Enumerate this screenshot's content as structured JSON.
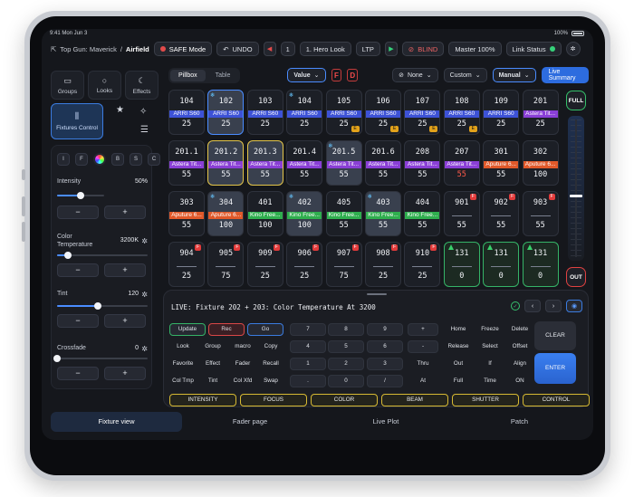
{
  "status": {
    "time": "9:41 Mon Jun 3",
    "battery": "100%"
  },
  "topbar": {
    "show": "Top Gun: Maverick",
    "separator": "/",
    "scene": "Airfield",
    "safe_mode": "SAFE Mode",
    "undo": "UNDO",
    "cue_number": "1",
    "cue_name": "1. Hero Look",
    "ltp": "LTP",
    "blind": "BLIND",
    "master": "Master 100%",
    "link_status": "Link Status"
  },
  "left": {
    "modes": [
      {
        "label": "Groups",
        "icon": "folder-icon"
      },
      {
        "label": "Looks",
        "icon": "bulb-icon"
      },
      {
        "label": "Effects",
        "icon": "moon-icon"
      }
    ],
    "fixtures_control": "Fixtures Control",
    "attributes": [
      "I",
      "F",
      "B",
      "S",
      "C"
    ],
    "params": [
      {
        "label": "Intensity",
        "value": "50%",
        "level": 0.5
      },
      {
        "label": "Color Temperature",
        "value": "3200K",
        "level": 0.12
      },
      {
        "label": "Tint",
        "value": "120",
        "level": 0.45
      },
      {
        "label": "Crossfade",
        "value": "0",
        "level": 0.0
      }
    ],
    "minus": "−",
    "plus": "+"
  },
  "toolbar": {
    "view_tabs": [
      "Pillbox",
      "Table"
    ],
    "value_dd": "Value",
    "f_btn": "F",
    "d_btn": "D",
    "none_dd": "None",
    "custom_dd": "Custom",
    "manual_dd": "Manual",
    "live_summary": "Live Summary"
  },
  "fixtures": [
    [
      {
        "num": "104",
        "band": "ARRI S60",
        "color": "#3d52d6",
        "val": "25",
        "snow": false,
        "badge": "",
        "ebadge": ""
      },
      {
        "num": "102",
        "band": "ARRI S60",
        "color": "#3d52d6",
        "val": "25",
        "snow": true,
        "sel": true,
        "border": "#4a8cff",
        "badge": "",
        "ebadge": ""
      },
      {
        "num": "103",
        "band": "ARRI S60",
        "color": "#3d52d6",
        "val": "25",
        "badge": "",
        "ebadge": ""
      },
      {
        "num": "104",
        "band": "ARRI S60",
        "color": "#3d52d6",
        "val": "25",
        "snow": true,
        "badge": "",
        "ebadge": ""
      },
      {
        "num": "105",
        "band": "ARRI S60",
        "color": "#3d52d6",
        "val": "25",
        "badge": "",
        "ebadge": "E"
      },
      {
        "num": "106",
        "band": "ARRI S60",
        "color": "#3d52d6",
        "val": "25",
        "badge": "",
        "ebadge": "E"
      },
      {
        "num": "107",
        "band": "ARRI S60",
        "color": "#3d52d6",
        "val": "25",
        "badge": "",
        "ebadge": "E"
      },
      {
        "num": "108",
        "band": "ARRI S60",
        "color": "#3d52d6",
        "val": "25",
        "badge": "",
        "ebadge": "E"
      },
      {
        "num": "109",
        "band": "ARRI S60",
        "color": "#3d52d6",
        "val": "25",
        "badge": "",
        "ebadge": ""
      },
      {
        "num": "201",
        "band": "Astera Tit...",
        "color": "#8a3fd6",
        "val": "25",
        "badge": "",
        "ebadge": ""
      }
    ],
    [
      {
        "num": "201.1",
        "band": "Astera Tit...",
        "color": "#8a3fd6",
        "val": "55"
      },
      {
        "num": "201.2",
        "band": "Astera Tit...",
        "color": "#8a3fd6",
        "val": "55",
        "sel": true,
        "border": "#e3c54a"
      },
      {
        "num": "201.3",
        "band": "Astera Tit...",
        "color": "#8a3fd6",
        "val": "55",
        "sel": true,
        "border": "#e3c54a"
      },
      {
        "num": "201.4",
        "band": "Astera Tit...",
        "color": "#8a3fd6",
        "val": "55"
      },
      {
        "num": "201.5",
        "band": "Astera Tit...",
        "color": "#8a3fd6",
        "val": "55",
        "snow": true,
        "sel": true
      },
      {
        "num": "201.6",
        "band": "Astera Tit...",
        "color": "#8a3fd6",
        "val": "55"
      },
      {
        "num": "208",
        "band": "Astera Tit...",
        "color": "#8a3fd6",
        "val": "55"
      },
      {
        "num": "207",
        "band": "Astera Tit...",
        "color": "#8a3fd6",
        "val": "55",
        "red": true
      },
      {
        "num": "301",
        "band": "Aputure 6...",
        "color": "#e0592a",
        "val": "55"
      },
      {
        "num": "302",
        "band": "Aputure 6...",
        "color": "#e0592a",
        "val": "100"
      }
    ],
    [
      {
        "num": "303",
        "band": "Aputure 6...",
        "color": "#e0592a",
        "val": "55"
      },
      {
        "num": "304",
        "band": "Aputure 6...",
        "color": "#e0592a",
        "val": "100",
        "snow": true,
        "sel": true
      },
      {
        "num": "401",
        "band": "Kino Free...",
        "color": "#2fae4e",
        "val": "100"
      },
      {
        "num": "402",
        "band": "Kino Free...",
        "color": "#2fae4e",
        "val": "100",
        "snow": true,
        "sel": true
      },
      {
        "num": "405",
        "band": "Kino Free...",
        "color": "#2fae4e",
        "val": "55"
      },
      {
        "num": "403",
        "band": "Kino Free...",
        "color": "#2fae4e",
        "val": "55",
        "snow": true,
        "sel": true
      },
      {
        "num": "404",
        "band": "Kino Free...",
        "color": "#2fae4e",
        "val": "55"
      },
      {
        "num": "901",
        "band": "",
        "color": "",
        "val": "55",
        "badge": "F",
        "line": true
      },
      {
        "num": "902",
        "band": "",
        "color": "",
        "val": "55",
        "badge": "F",
        "line": true
      },
      {
        "num": "903",
        "band": "",
        "color": "",
        "val": "55",
        "badge": "F",
        "line": true
      }
    ],
    [
      {
        "num": "904",
        "band": "",
        "color": "",
        "val": "25",
        "badge": "F",
        "line": true
      },
      {
        "num": "905",
        "band": "",
        "color": "",
        "val": "75",
        "badge": "F",
        "line": true
      },
      {
        "num": "909",
        "band": "",
        "color": "",
        "val": "25",
        "badge": "F",
        "line": true
      },
      {
        "num": "906",
        "band": "",
        "color": "",
        "val": "25",
        "badge": "F",
        "line": true
      },
      {
        "num": "907",
        "band": "",
        "color": "",
        "val": "75",
        "badge": "F",
        "line": true
      },
      {
        "num": "908",
        "band": "",
        "color": "",
        "val": "25",
        "badge": "F",
        "line": true
      },
      {
        "num": "910",
        "band": "",
        "color": "",
        "val": "25",
        "badge": "F",
        "line": true
      },
      {
        "num": "131",
        "band": "",
        "color": "",
        "val": "0",
        "green": true,
        "line": true
      },
      {
        "num": "131",
        "band": "",
        "color": "",
        "val": "0",
        "green": true,
        "line": true
      },
      {
        "num": "131",
        "band": "",
        "color": "",
        "val": "0",
        "green": true,
        "line": true
      }
    ]
  ],
  "fader": {
    "full": "FULL",
    "out": "OUT",
    "level": 0.45
  },
  "command": {
    "line": "LIVE: Fixture 202 + 203: Color Temperature At 3200",
    "nav_prev": "‹",
    "nav_next": "›",
    "keys": [
      [
        "Update",
        "Rec",
        "Go",
        "7",
        "8",
        "9",
        "+",
        "Home",
        "Freeze",
        "Delete"
      ],
      [
        "Look",
        "Group",
        "macro",
        "Copy",
        "4",
        "5",
        "6",
        "-",
        "Release",
        "Select",
        "Offset"
      ],
      [
        "Favorite",
        "Effect",
        "Fader",
        "Recall",
        "1",
        "2",
        "3",
        "Thru",
        "Out",
        "If",
        "Align"
      ],
      [
        "Col Tmp",
        "Tint",
        "Col Xfd",
        "Swap",
        ".",
        "0",
        "/",
        "At",
        "Full",
        "Time",
        "ON"
      ]
    ],
    "clear": "CLEAR",
    "enter": "ENTER",
    "categories": [
      "INTENSITY",
      "FOCUS",
      "COLOR",
      "BEAM",
      "SHUTTER",
      "CONTROL"
    ]
  },
  "tabs": [
    "Fixture view",
    "Fader page",
    "Live Plot",
    "Patch"
  ],
  "colors": {
    "accent": "#2d6cdf",
    "go": "#35b367",
    "rec": "#d94747",
    "category": "#d6b933"
  }
}
